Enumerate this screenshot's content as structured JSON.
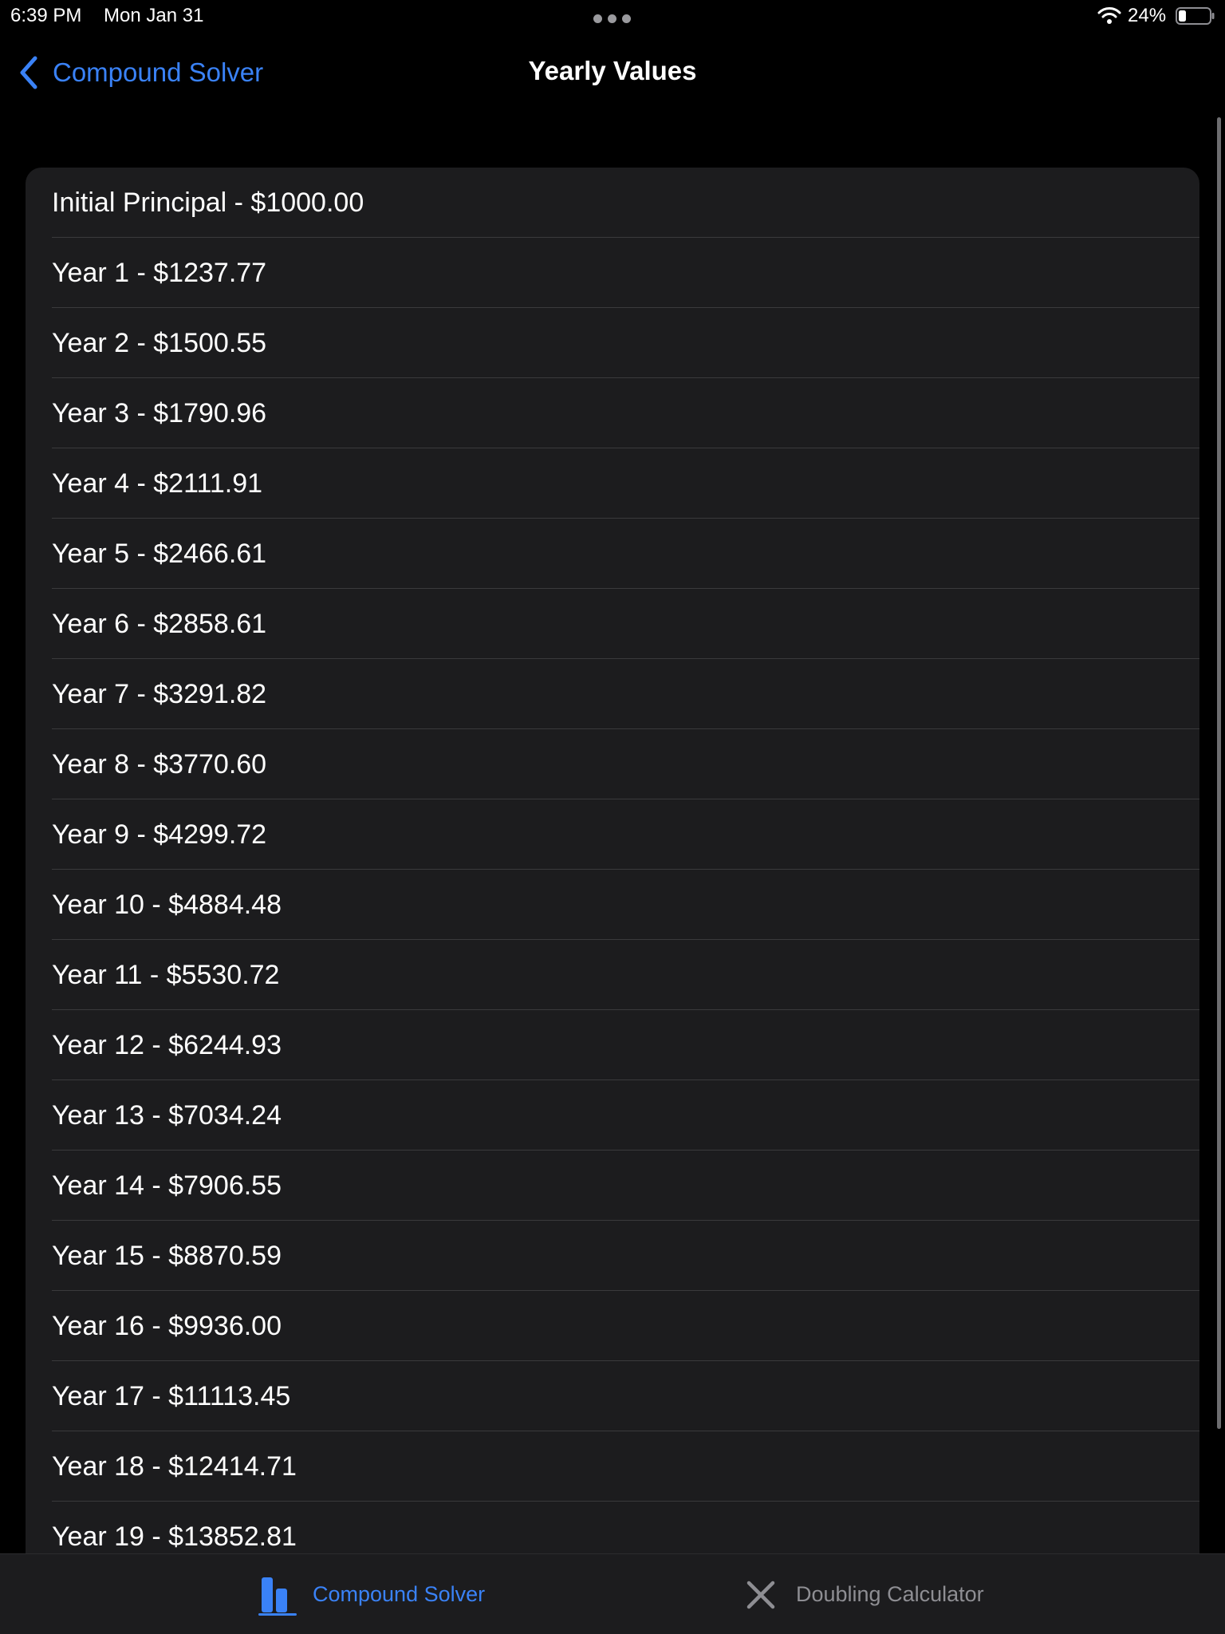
{
  "status_bar": {
    "time": "6:39 PM",
    "date": "Mon Jan 31",
    "battery_percent": "24%",
    "battery_level": 0.24
  },
  "nav": {
    "back_label": "Compound Solver",
    "title": "Yearly Values"
  },
  "rows": [
    "Initial Principal - $1000.00",
    "Year 1 - $1237.77",
    "Year 2 - $1500.55",
    "Year 3 - $1790.96",
    "Year 4 - $2111.91",
    "Year 5 - $2466.61",
    "Year 6 - $2858.61",
    "Year 7 - $3291.82",
    "Year 8 - $3770.60",
    "Year 9 - $4299.72",
    "Year 10 - $4884.48",
    "Year 11 - $5530.72",
    "Year 12 - $6244.93",
    "Year 13 - $7034.24",
    "Year 14 - $7906.55",
    "Year 15 - $8870.59",
    "Year 16 - $9936.00",
    "Year 17 - $11113.45",
    "Year 18 - $12414.71",
    "Year 19 - $13852.81"
  ],
  "tab_bar": {
    "tabs": [
      {
        "label": "Compound Solver",
        "icon": "bar-chart-icon",
        "active": true
      },
      {
        "label": "Doubling Calculator",
        "icon": "multiply-icon",
        "active": false
      }
    ]
  },
  "colors": {
    "accent": "#3a82f7",
    "background": "#000000",
    "card": "#1c1c1e",
    "inactive": "#8e8e93"
  }
}
